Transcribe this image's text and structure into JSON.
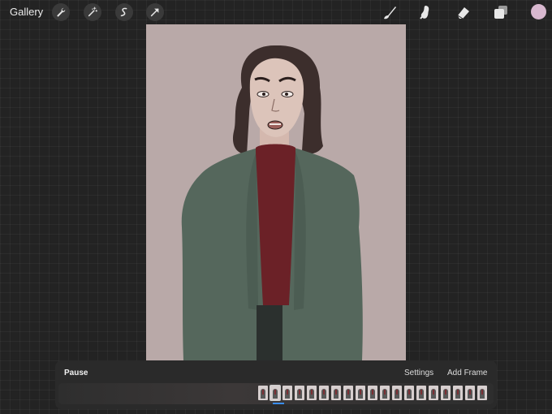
{
  "toolbar": {
    "gallery_label": "Gallery",
    "left_tools": [
      "wrench-icon",
      "magic-wand-icon",
      "selection-icon",
      "transform-arrow-icon"
    ],
    "right_tools": [
      "brush-icon",
      "smudge-icon",
      "eraser-icon",
      "layers-icon"
    ],
    "current_color": "#d8b8cf"
  },
  "canvas": {
    "background_color": "#b9a9a8"
  },
  "animation_assist": {
    "playback_label": "Pause",
    "settings_label": "Settings",
    "add_frame_label": "Add Frame",
    "frame_count": 19,
    "current_frame": 2,
    "playhead_color": "#3a8ef6"
  }
}
